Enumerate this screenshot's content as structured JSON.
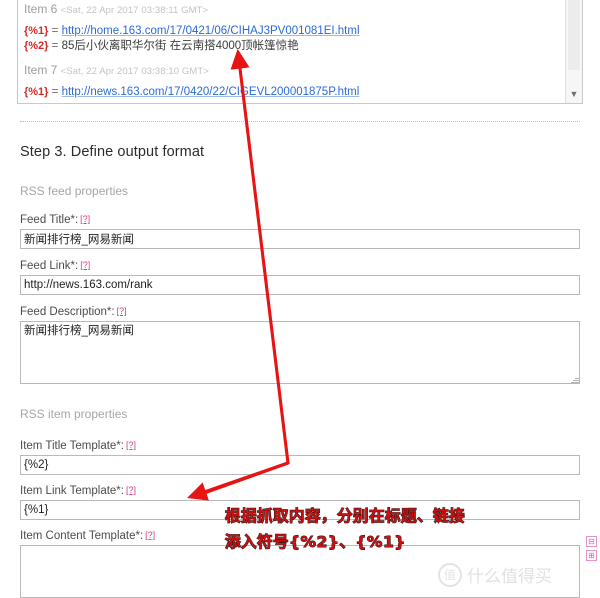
{
  "preview": {
    "items": [
      {
        "label": "Item 6",
        "date": "<Sat, 22 Apr 2017 03:38:11 GMT>",
        "fields": [
          {
            "key": "{%1}",
            "eq": "=",
            "value": "http://home.163.com/17/0421/06/CIHAJ3PV001081EI.html",
            "kind": "link"
          },
          {
            "key": "{%2}",
            "eq": "=",
            "value": "85后小伙离职华尔街 在云南搭4000顶帐篷惊艳",
            "kind": "text"
          }
        ]
      },
      {
        "label": "Item 7",
        "date": "<Sat, 22 Apr 2017 03:38:10 GMT>",
        "fields": [
          {
            "key": "{%1}",
            "eq": "=",
            "value": "http://news.163.com/17/0420/22/CIGEVL200001875P.html",
            "kind": "link"
          }
        ]
      }
    ],
    "scroll_down_glyph": "▼"
  },
  "form": {
    "step_title": "Step 3. Define output format",
    "feed_section_label": "RSS feed properties",
    "item_section_label": "RSS item properties",
    "help_glyph": "[?]",
    "fields": {
      "feed_title": {
        "label": "Feed Title*:",
        "value": "新闻排行榜_网易新闻",
        "placeholder": ""
      },
      "feed_link": {
        "label": "Feed Link*:",
        "value": "http://news.163.com/rank",
        "placeholder": ""
      },
      "feed_description": {
        "label": "Feed Description*:",
        "value": "新闻排行榜_网易新闻",
        "placeholder": ""
      },
      "item_title_template": {
        "label": "Item Title Template*:",
        "value": "{%2}",
        "placeholder": ""
      },
      "item_link_template": {
        "label": "Item Link Template*:",
        "value": "{%1}",
        "placeholder": ""
      },
      "item_content_template": {
        "label": "Item Content Template*:",
        "value": "",
        "placeholder": ""
      }
    }
  },
  "corner_icons": {
    "collapse": "⊟",
    "expand": "⊞"
  },
  "annotation": {
    "text": "根据抓取内容，分别在标题、链接\n添入符号{%2}、{%1}",
    "color": "#d01010"
  },
  "watermark": {
    "text": "什么值得买",
    "mark": "值"
  }
}
